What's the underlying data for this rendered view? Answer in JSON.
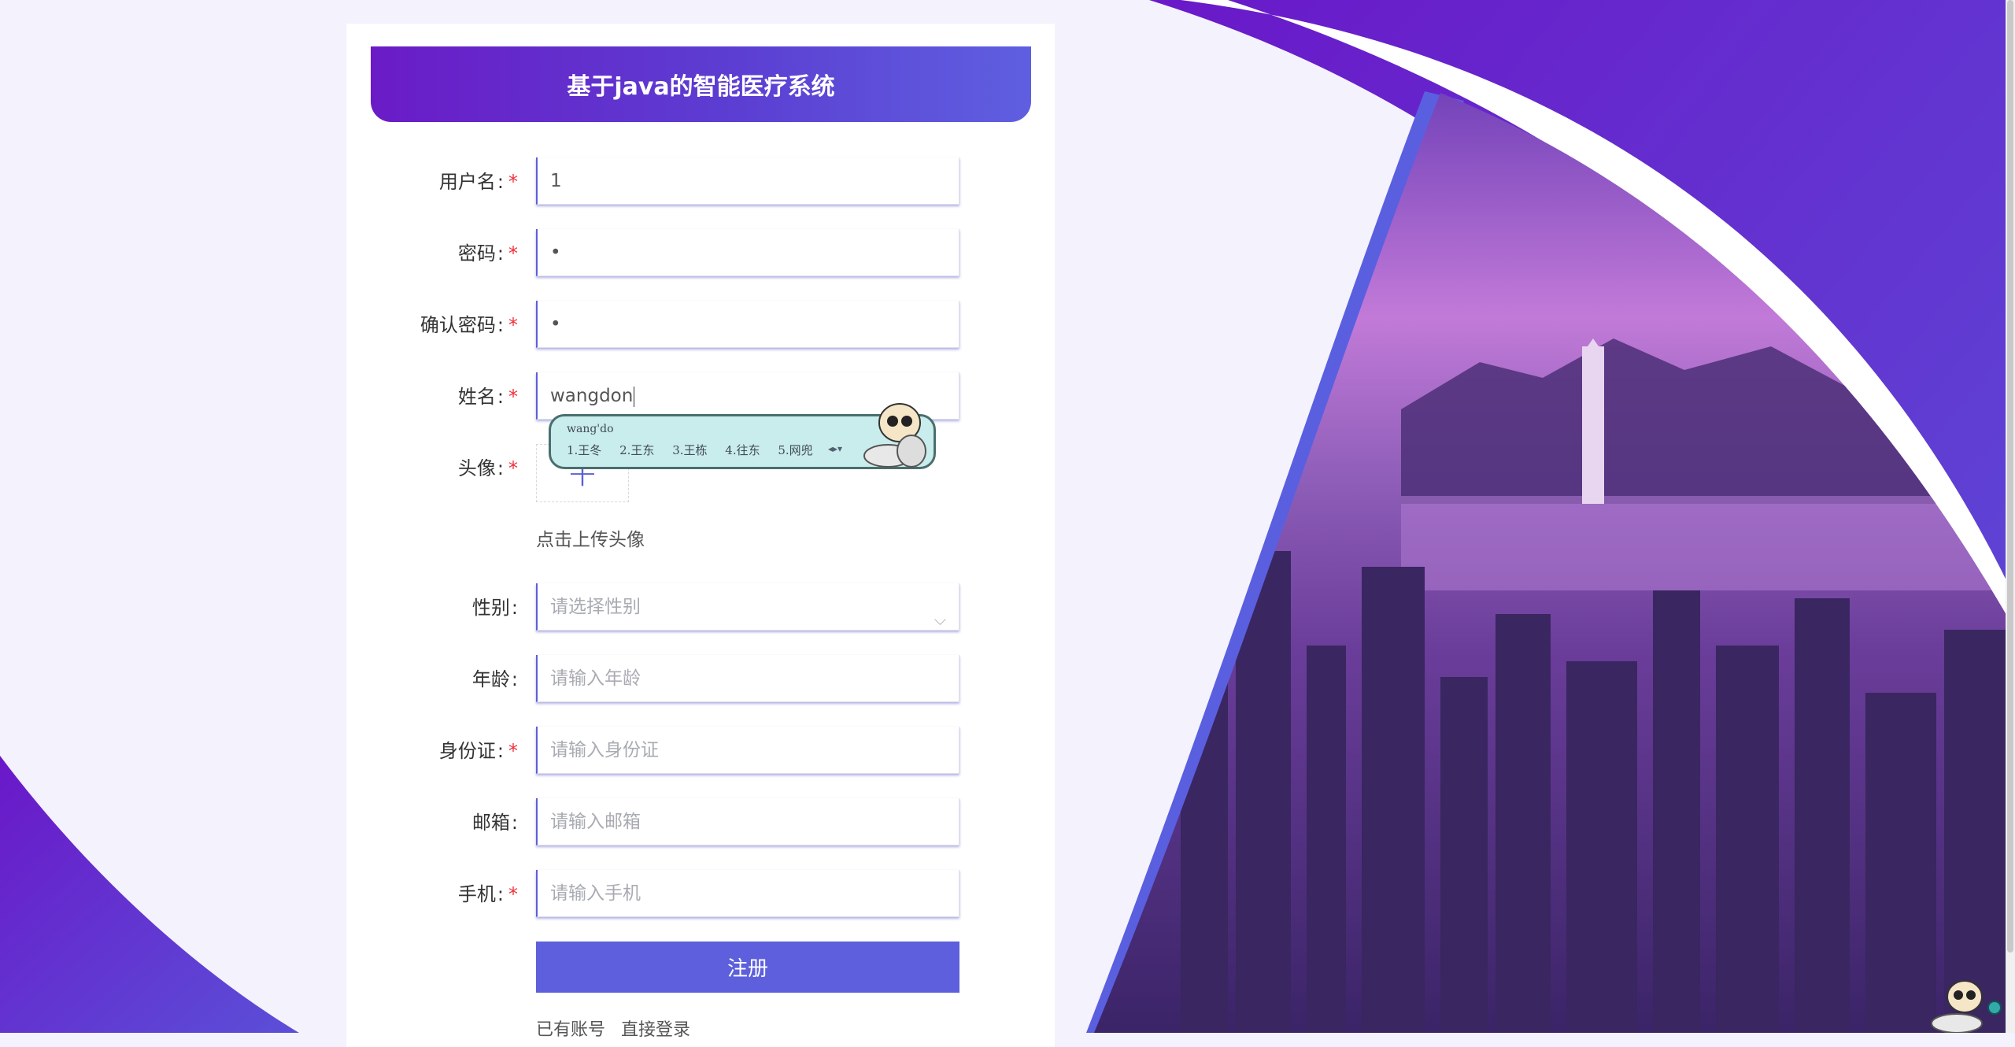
{
  "header": {
    "title": "基于java的智能医疗系统"
  },
  "form": {
    "colon": ":",
    "required_mark": "*",
    "fields": [
      {
        "label": "用户名",
        "required": true,
        "value": "1"
      },
      {
        "label": "密码",
        "required": true,
        "value": "•"
      },
      {
        "label": "确认密码",
        "required": true,
        "value": "•"
      },
      {
        "label": "姓名",
        "required": true,
        "value": "wangdon"
      },
      {
        "label": "头像",
        "required": true
      },
      {
        "label": "性别",
        "required": false,
        "placeholder": "请选择性别"
      },
      {
        "label": "年龄",
        "required": false,
        "placeholder": "请输入年龄"
      },
      {
        "label": "身份证",
        "required": true,
        "placeholder": "请输入身份证"
      },
      {
        "label": "邮箱",
        "required": false,
        "placeholder": "请输入邮箱"
      },
      {
        "label": "手机",
        "required": true,
        "placeholder": "请输入手机"
      }
    ],
    "avatar_plus": "+",
    "avatar_hint": "点击上传头像",
    "select_chevron": "chevron-down-icon",
    "register_label": "注册",
    "login_prefix": "已有账号",
    "login_link": "直接登录"
  },
  "ime": {
    "pinyin": "wang'do",
    "candidates": [
      "1.王冬",
      "2.王东",
      "3.王栋",
      "4.往东",
      "5.网兜"
    ],
    "arrows": "◂▸▾"
  },
  "colors": {
    "accent": "#5d5fdc",
    "header_gradient_start": "#6a1bc6",
    "header_gradient_end": "#5f5fe0",
    "background_purple": "#6b22cc",
    "required": "#f0323c"
  }
}
